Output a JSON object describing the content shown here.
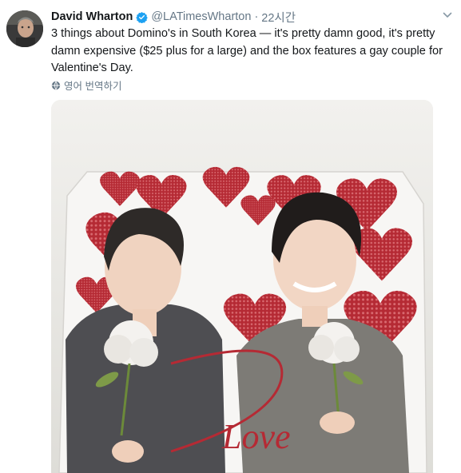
{
  "tweet": {
    "display_name": "David Wharton",
    "handle": "@LATimesWharton",
    "separator": "·",
    "time": "22시간",
    "text": "3 things about Domino's in South Korea — it's pretty damn good, it's pretty damn expensive ($25 plus for a large) and the box features a gay couple for Valentine's Day.",
    "translate_label": "영어 번역하기",
    "media_text": "Love"
  },
  "colors": {
    "verified": "#1da1f2",
    "secondary_text": "#657786",
    "primary_text": "#14171a",
    "heart": "#b52a34"
  },
  "icons": {
    "verified": "verified-badge-icon",
    "menu": "chevron-down-icon",
    "translate": "globe-icon"
  }
}
